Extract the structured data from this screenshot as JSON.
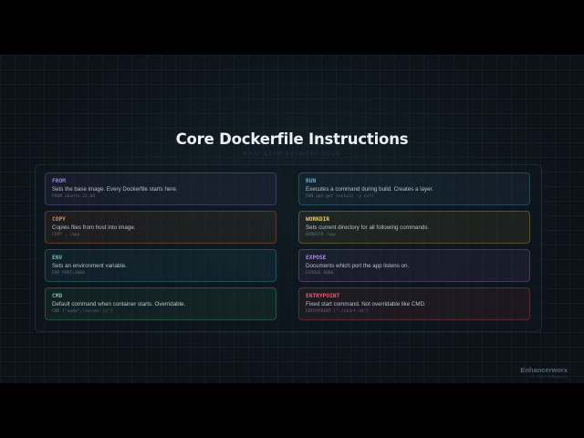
{
  "page": {
    "title": "Core Dockerfile Instructions",
    "subtitle": "What each keyword does"
  },
  "cards": [
    {
      "keyword": "FROM",
      "description": "Sets the base image. Every Dockerfile starts here.",
      "example": "FROM ubuntu:22.04",
      "accent": "#9a7cf2"
    },
    {
      "keyword": "RUN",
      "description": "Executes a command during build. Creates a layer.",
      "example": "RUN apt-get install -y curl",
      "accent": "#4fb1e6"
    },
    {
      "keyword": "COPY",
      "description": "Copies files from host into image.",
      "example": "COPY . /app",
      "accent": "#f0874a"
    },
    {
      "keyword": "WORKDIR",
      "description": "Sets current directory for all following commands.",
      "example": "WORKDIR /app",
      "accent": "#f2cc4c"
    },
    {
      "keyword": "ENV",
      "description": "Sets an environment variable.",
      "example": "ENV PORT=3000",
      "accent": "#3fc6d8"
    },
    {
      "keyword": "EXPOSE",
      "description": "Documents which port the app listens on.",
      "example": "EXPOSE 8080",
      "accent": "#b685f0"
    },
    {
      "keyword": "CMD",
      "description": "Default command when container starts. Overridable.",
      "example": "CMD [\"node\",\"server.js\"]",
      "accent": "#4ed38a"
    },
    {
      "keyword": "ENTRYPOINT",
      "description": "Fixed start command. Not overridable like CMD.",
      "example": "ENTRYPOINT [\"./start.sh\"]",
      "accent": "#f0556a"
    }
  ],
  "brand": {
    "name": "Enhancerworx",
    "tagline": "IT TUTORIALS"
  }
}
